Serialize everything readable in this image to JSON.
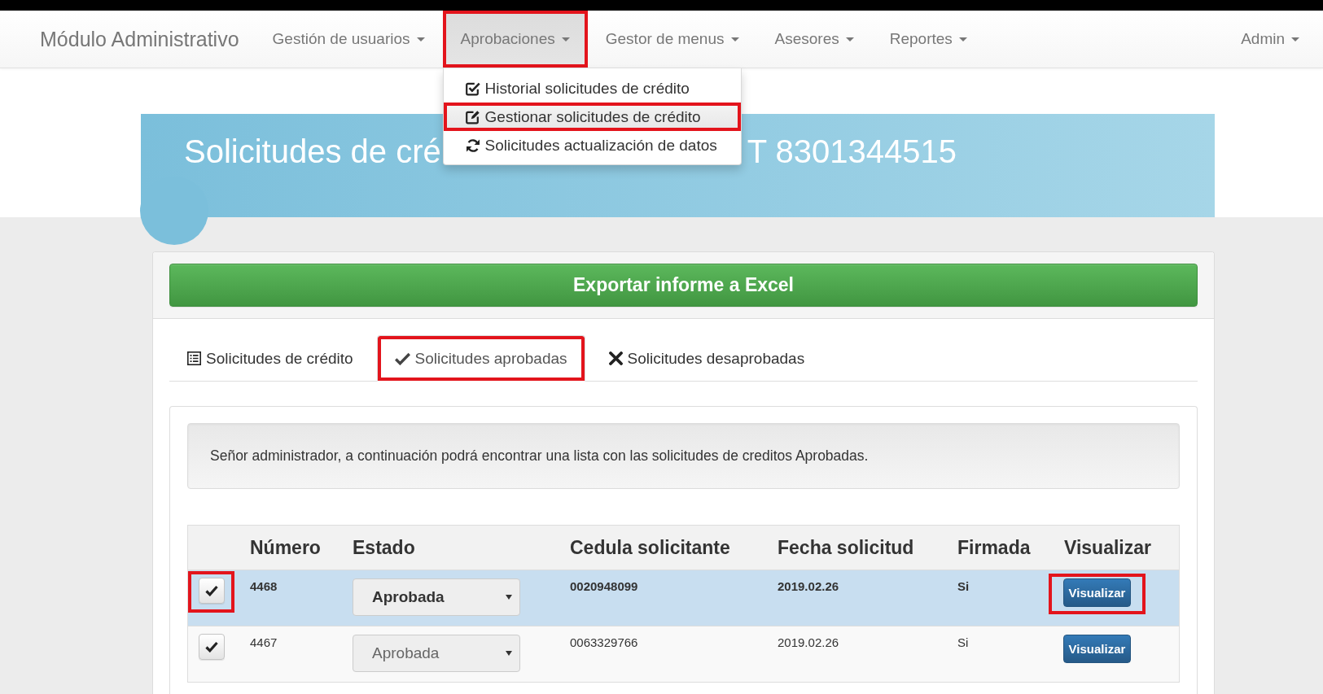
{
  "navbar": {
    "brand": "Módulo Administrativo",
    "items": [
      {
        "label": "Gestión de usuarios",
        "expanded": false,
        "highlighted": false
      },
      {
        "label": "Aprobaciones",
        "expanded": true,
        "highlighted": true,
        "menu": [
          {
            "label": "Historial solicitudes de crédito",
            "selected": false,
            "highlighted": false
          },
          {
            "label": "Gestionar solicitudes de crédito",
            "selected": true,
            "highlighted": true
          },
          {
            "label": "Solicitudes actualización de datos",
            "selected": false,
            "highlighted": false
          }
        ]
      },
      {
        "label": "Gestor de menus",
        "expanded": false,
        "highlighted": false
      },
      {
        "label": "Asesores",
        "expanded": false,
        "highlighted": false
      },
      {
        "label": "Reportes",
        "expanded": false,
        "highlighted": false
      }
    ],
    "user_menu": {
      "label": "Admin"
    }
  },
  "header": {
    "title_parts": [
      "Solicitudes de cré",
      "T 8301344515"
    ]
  },
  "panel": {
    "export_button": "Exportar informe a Excel",
    "tabs": [
      {
        "label": "Solicitudes de crédito",
        "selected": false,
        "highlighted": false
      },
      {
        "label": "Solicitudes aprobadas",
        "selected": true,
        "highlighted": true
      },
      {
        "label": "Solicitudes desaprobadas",
        "selected": false,
        "highlighted": false
      }
    ],
    "notice": "Señor administrador, a continuación podrá encontrar una lista con las solicitudes de creditos Aprobadas.",
    "table": {
      "columns": [
        "Número",
        "Estado",
        "Cedula solicitante",
        "Fecha solicitud",
        "Firmada",
        "Visualizar"
      ],
      "rows": [
        {
          "checked": true,
          "selected": true,
          "highlighted": true,
          "numero": "4468",
          "estado": "Aprobada",
          "cedula": "0020948099",
          "fecha": "2019.02.26",
          "firmada": "Si",
          "action": "Visualizar"
        },
        {
          "checked": true,
          "selected": false,
          "highlighted": false,
          "numero": "4467",
          "estado": "Aprobada",
          "cedula": "0063329766",
          "fecha": "2019.02.26",
          "firmada": "Si",
          "action": "Visualizar"
        }
      ]
    }
  }
}
